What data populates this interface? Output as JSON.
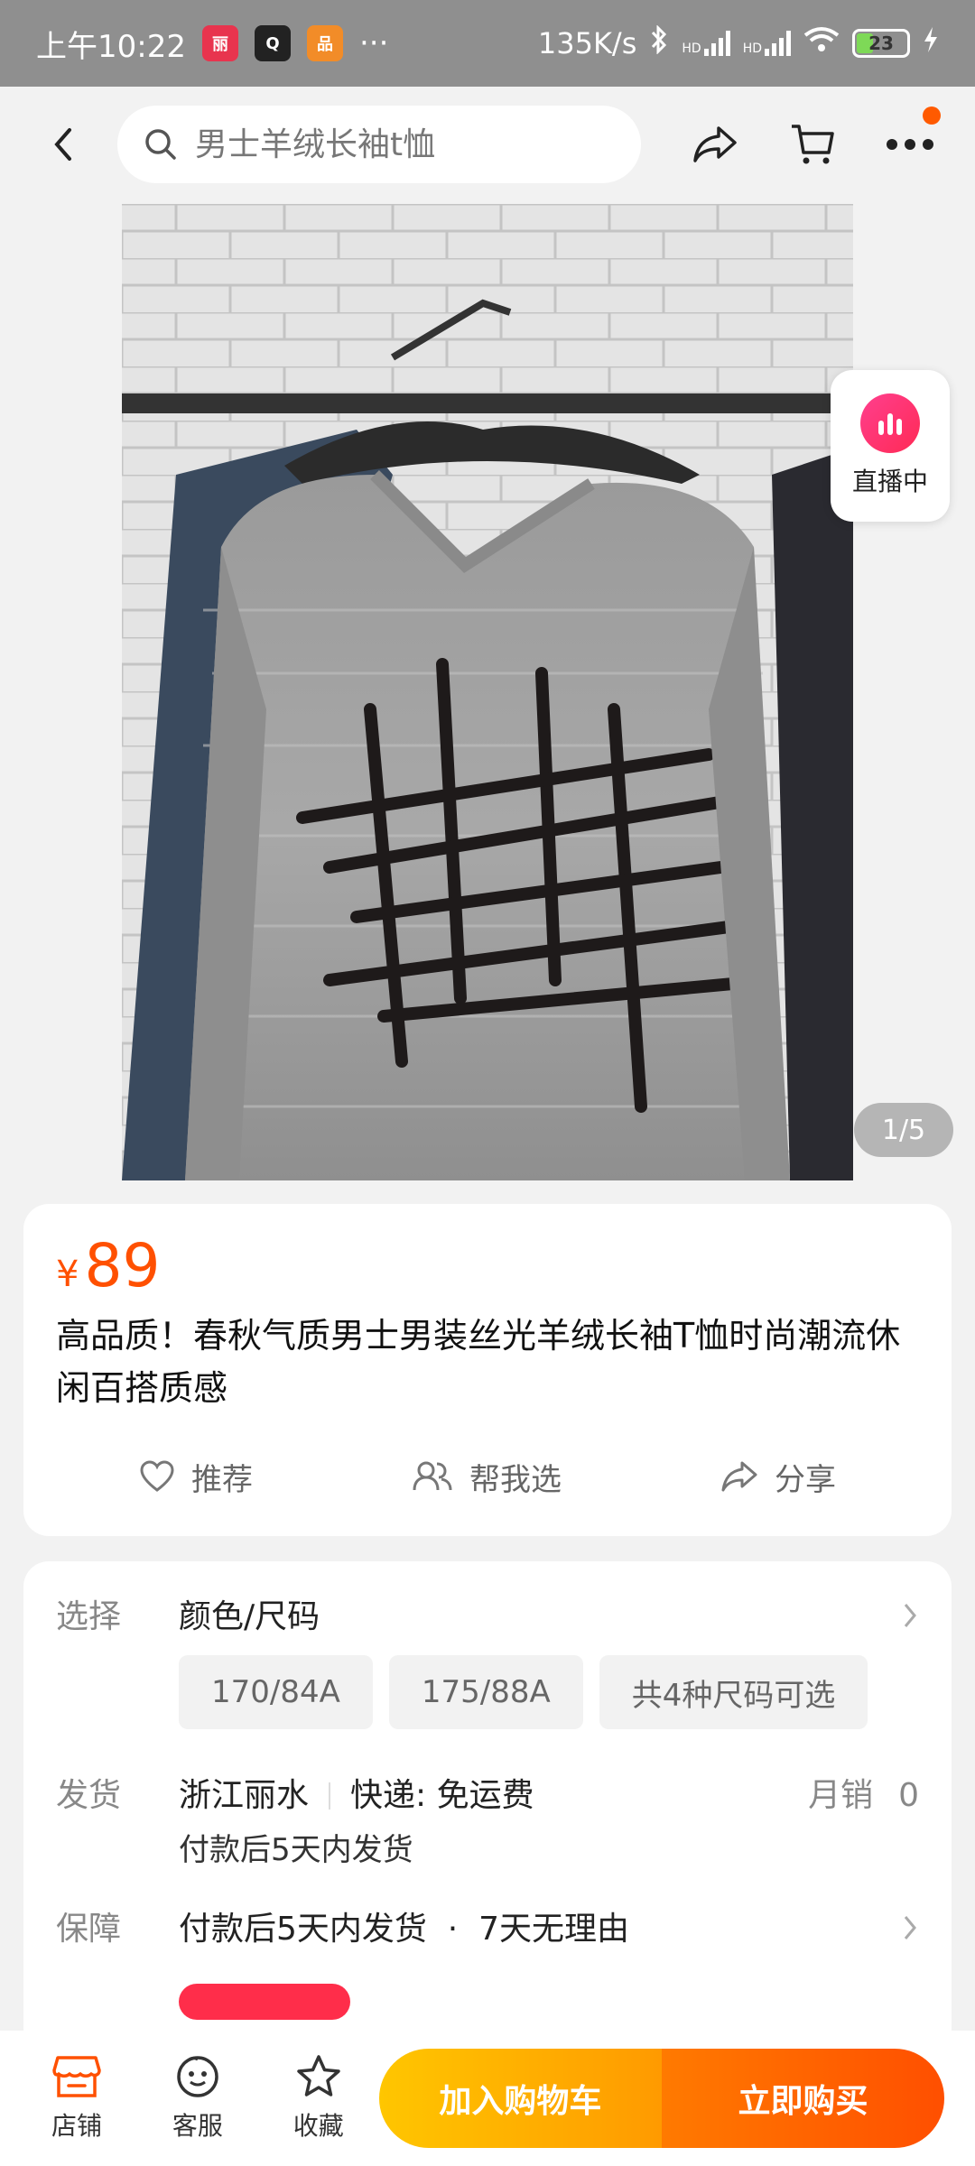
{
  "status_bar": {
    "time": "上午10:22",
    "apps": [
      {
        "label": "丽",
        "color": "#e8344e"
      },
      {
        "label": "Q",
        "color": "#222222"
      },
      {
        "label": "品",
        "color": "#f28c28"
      }
    ],
    "more": "···",
    "network_speed": "135K/s",
    "hd1": "HD",
    "hd2": "HD",
    "battery": "23"
  },
  "nav": {
    "search_placeholder": "男士羊绒长袖t恤"
  },
  "gallery": {
    "live_label": "直播中",
    "page_indicator": "1/5"
  },
  "product": {
    "currency": "¥",
    "price": "89",
    "title": "高品质！春秋气质男士男装丝光羊绒长袖T恤时尚潮流休闲百搭质感",
    "actions": {
      "recommend": "推荐",
      "help_choose": "帮我选",
      "share": "分享"
    }
  },
  "details": {
    "select_label": "选择",
    "select_value": "颜色/尺码",
    "sizes": [
      "170/84A",
      "175/88A",
      "共4种尺码可选"
    ],
    "ship_label": "发货",
    "ship_from": "浙江丽水",
    "ship_method": "快递: 免运费",
    "monthly_label": "月销",
    "monthly_value": "0",
    "ship_time": "付款后5天内发货",
    "guarantee_label": "保障",
    "guarantee_value": "付款后5天内发货  ·  7天无理由"
  },
  "bottom_bar": {
    "shop": "店铺",
    "service": "客服",
    "favorite": "收藏",
    "add_to_cart": "加入购物车",
    "buy_now": "立即购买"
  },
  "colors": {
    "accent": "#ff5000",
    "cart_gradient": [
      "#ffc600",
      "#ff9a00"
    ],
    "buy_gradient": [
      "#ff7a00",
      "#ff4f00"
    ]
  }
}
